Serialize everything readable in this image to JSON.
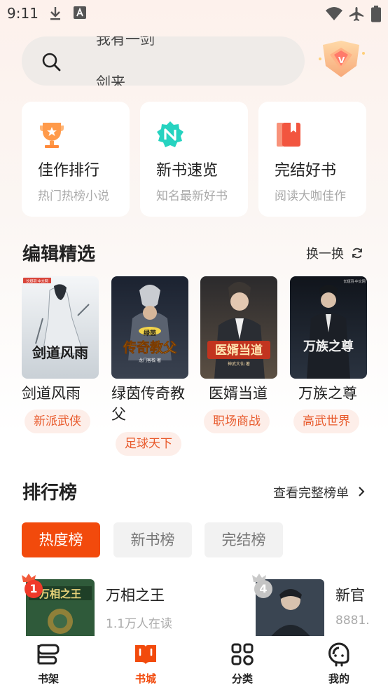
{
  "status_bar": {
    "time": "9:11",
    "icons": [
      "download-icon",
      "a-icon",
      "wifi-icon",
      "airplane-icon",
      "battery-icon"
    ]
  },
  "search": {
    "ticker_prev": "我有一剑",
    "ticker_next": "剑来"
  },
  "quick_links": [
    {
      "title": "佳作排行",
      "subtitle": "热门热榜小说",
      "icon": "trophy-icon"
    },
    {
      "title": "新书速览",
      "subtitle": "知名最新好书",
      "icon": "new-badge-icon"
    },
    {
      "title": "完结好书",
      "subtitle": "阅读大咖佳作",
      "icon": "book-bookmark-icon"
    }
  ],
  "editor_picks": {
    "title": "编辑精选",
    "action": "换一换",
    "books": [
      {
        "name": "剑道风雨",
        "tag": "新派武侠",
        "cover_text": "剑道风雨",
        "cover_publisher": "长翅羽·中文网"
      },
      {
        "name": "绿茵传奇教父",
        "tag": "足球天下",
        "cover_text": "传奇教父",
        "cover_small": "绿茵",
        "cover_author": "龙门客栈 著"
      },
      {
        "name": "医婿当道",
        "tag": "职场商战",
        "cover_text": "医婿当道",
        "cover_small": "神武大仙 著"
      },
      {
        "name": "万族之尊",
        "tag": "高武世界",
        "cover_text": "万族之尊",
        "cover_publisher": "长翅羽·中文网"
      }
    ]
  },
  "rankings": {
    "title": "排行榜",
    "action": "查看完整榜单",
    "tabs": [
      "热度榜",
      "新书榜",
      "完结榜"
    ],
    "active_tab": 0,
    "items": [
      {
        "rank": "1",
        "title": "万相之王",
        "sub": "1.1万人在读",
        "cover_text": "万相之王"
      },
      {
        "rank": "4",
        "title": "新官",
        "sub": "8881."
      }
    ]
  },
  "bottom_nav": [
    {
      "label": "书架",
      "icon": "bookshelf-icon"
    },
    {
      "label": "书城",
      "icon": "bookstore-icon"
    },
    {
      "label": "分类",
      "icon": "category-grid-icon"
    },
    {
      "label": "我的",
      "icon": "profile-icon"
    }
  ],
  "colors": {
    "accent": "#f24a0c",
    "tag_bg": "#fdeee9",
    "tag_text": "#e85a2c"
  }
}
